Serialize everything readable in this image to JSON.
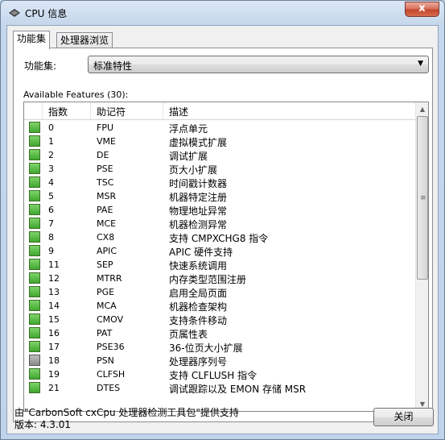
{
  "window": {
    "title": "CPU 信息",
    "close_glyph": "x"
  },
  "tabs": [
    {
      "label": "功能集"
    },
    {
      "label": "处理器浏览"
    }
  ],
  "feature_set": {
    "label": "功能集:",
    "value": "标准特性",
    "arrow": "▼"
  },
  "list": {
    "caption": "Available Features (30):",
    "columns": {
      "index": "指数",
      "mnemonic": "助记符",
      "description": "描述"
    },
    "rows": [
      {
        "index": "0",
        "mnemonic": "FPU",
        "description": "浮点单元",
        "status": "green"
      },
      {
        "index": "1",
        "mnemonic": "VME",
        "description": "虚拟模式扩展",
        "status": "green"
      },
      {
        "index": "2",
        "mnemonic": "DE",
        "description": "调试扩展",
        "status": "green"
      },
      {
        "index": "3",
        "mnemonic": "PSE",
        "description": "页大小扩展",
        "status": "green"
      },
      {
        "index": "4",
        "mnemonic": "TSC",
        "description": "时间戳计数器",
        "status": "green"
      },
      {
        "index": "5",
        "mnemonic": "MSR",
        "description": "机器特定注册",
        "status": "green"
      },
      {
        "index": "6",
        "mnemonic": "PAE",
        "description": "物理地址异常",
        "status": "green"
      },
      {
        "index": "7",
        "mnemonic": "MCE",
        "description": "机器检测异常",
        "status": "green"
      },
      {
        "index": "8",
        "mnemonic": "CX8",
        "description": "支持 CMPXCHG8 指令",
        "status": "green"
      },
      {
        "index": "9",
        "mnemonic": "APIC",
        "description": "APIC 硬件支持",
        "status": "green"
      },
      {
        "index": "11",
        "mnemonic": "SEP",
        "description": "快速系统调用",
        "status": "green"
      },
      {
        "index": "12",
        "mnemonic": "MTRR",
        "description": "内存类型范围注册",
        "status": "green"
      },
      {
        "index": "13",
        "mnemonic": "PGE",
        "description": "启用全局页面",
        "status": "green"
      },
      {
        "index": "14",
        "mnemonic": "MCA",
        "description": "机器检查架构",
        "status": "green"
      },
      {
        "index": "15",
        "mnemonic": "CMOV",
        "description": "支持条件移动",
        "status": "green"
      },
      {
        "index": "16",
        "mnemonic": "PAT",
        "description": "页属性表",
        "status": "green"
      },
      {
        "index": "17",
        "mnemonic": "PSE36",
        "description": "36-位页大小扩展",
        "status": "green"
      },
      {
        "index": "18",
        "mnemonic": "PSN",
        "description": "处理器序列号",
        "status": "gray"
      },
      {
        "index": "19",
        "mnemonic": "CLFSH",
        "description": "支持 CLFLUSH 指令",
        "status": "green"
      },
      {
        "index": "21",
        "mnemonic": "DTES",
        "description": "调试跟踪以及 EMON 存储 MSR",
        "status": "green"
      }
    ]
  },
  "footer": {
    "credit": "由\"CarbonSoft cxCpu 处理器检测工具包\"提供支持",
    "version": "版本: 4.3.01",
    "close_label": "关闭"
  },
  "icons": {
    "app": "cpu-chip-icon",
    "status_on": "#4db83a",
    "status_off": "#9a9a9a"
  }
}
